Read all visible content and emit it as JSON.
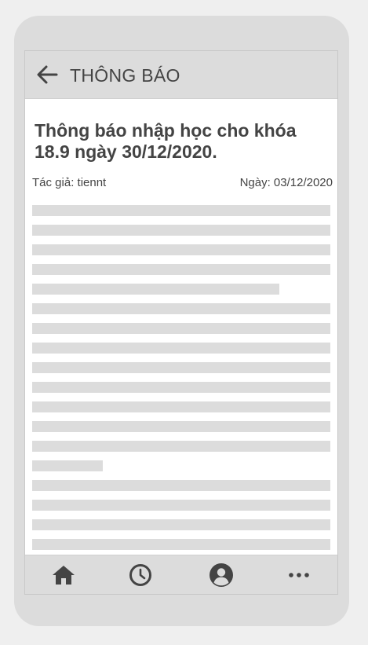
{
  "header": {
    "title": "THÔNG BÁO",
    "back_icon": "arrow-left-icon"
  },
  "article": {
    "title": "Thông báo nhập học cho khóa 18.9 ngày 30/12/2020.",
    "author": "Tác giả: tiennt",
    "date": "Ngày: 03/12/2020"
  },
  "bottom_nav": {
    "items": [
      {
        "icon": "home-icon"
      },
      {
        "icon": "clock-icon"
      },
      {
        "icon": "user-icon"
      },
      {
        "icon": "more-icon"
      }
    ]
  },
  "colors": {
    "icon": "#444444",
    "frame": "#dcdcdc",
    "placeholder_line": "#dcdcdc"
  }
}
